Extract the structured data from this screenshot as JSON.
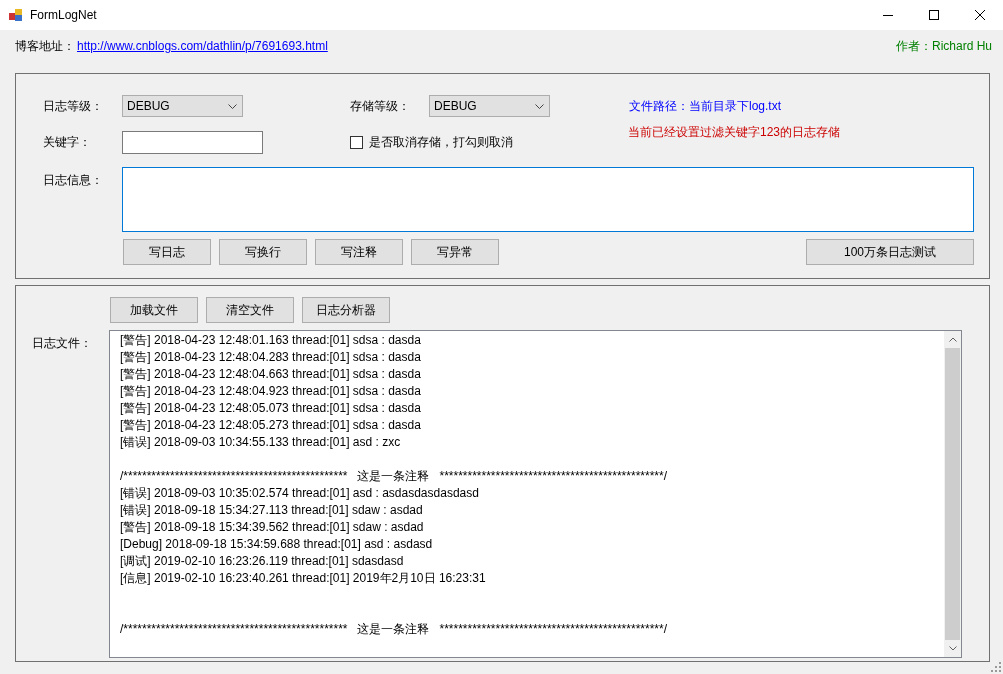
{
  "window": {
    "title": "FormLogNet"
  },
  "header": {
    "blog_label": "博客地址：",
    "blog_link": "http://www.cnblogs.com/dathlin/p/7691693.html",
    "author": "作者：Richard Hu"
  },
  "write_panel": {
    "log_level": {
      "label": "日志等级：",
      "value": "DEBUG"
    },
    "store_level": {
      "label": "存储等级：",
      "value": "DEBUG"
    },
    "file_path": "文件路径：当前目录下log.txt",
    "keyword": {
      "label": "关键字："
    },
    "cancel_store": {
      "label": "是否取消存储，打勾则取消",
      "checked": false
    },
    "filter_notice": "当前已经设置过滤关键字123的日志存储",
    "message": {
      "label": "日志信息："
    },
    "buttons": [
      "写日志",
      "写换行",
      "写注释",
      "写异常"
    ],
    "test_button": "100万条日志测试"
  },
  "file_panel": {
    "buttons": [
      "加载文件",
      "清空文件",
      "日志分析器"
    ],
    "label": "日志文件：",
    "lines": [
      {
        "kind": "entry",
        "text": "[警告] 2018-04-23 12:48:01.163 thread:[01] sdsa : dasda"
      },
      {
        "kind": "entry",
        "text": "[警告] 2018-04-23 12:48:04.283 thread:[01] sdsa : dasda"
      },
      {
        "kind": "entry",
        "text": "[警告] 2018-04-23 12:48:04.663 thread:[01] sdsa : dasda"
      },
      {
        "kind": "entry",
        "text": "[警告] 2018-04-23 12:48:04.923 thread:[01] sdsa : dasda"
      },
      {
        "kind": "entry",
        "text": "[警告] 2018-04-23 12:48:05.073 thread:[01] sdsa : dasda"
      },
      {
        "kind": "entry",
        "text": "[警告] 2018-04-23 12:48:05.273 thread:[01] sdsa : dasda"
      },
      {
        "kind": "entry",
        "text": "[错误] 2018-09-03 10:34:55.133 thread:[01] asd : zxc"
      },
      {
        "kind": "blank"
      },
      {
        "kind": "entry",
        "text": "/************************************************   这是一条注释   ************************************************/"
      },
      {
        "kind": "entry",
        "text": "[错误] 2018-09-03 10:35:02.574 thread:[01] asd : asdasdasdasdasd"
      },
      {
        "kind": "entry",
        "text": "[错误] 2018-09-18 15:34:27.113 thread:[01] sdaw : asdad"
      },
      {
        "kind": "entry",
        "text": "[警告] 2018-09-18 15:34:39.562 thread:[01] sdaw : asdad"
      },
      {
        "kind": "entry",
        "text": "[Debug] 2018-09-18 15:34:59.688 thread:[01] asd : asdasd"
      },
      {
        "kind": "entry",
        "text": "[调试] 2019-02-10 16:23:26.119 thread:[01] sdasdasd"
      },
      {
        "kind": "entry",
        "text": "[信息] 2019-02-10 16:23:40.261 thread:[01] 2019年2月10日 16:23:31"
      },
      {
        "kind": "blank"
      },
      {
        "kind": "blank"
      },
      {
        "kind": "entry",
        "text": "/************************************************   这是一条注释   ************************************************/"
      }
    ]
  }
}
